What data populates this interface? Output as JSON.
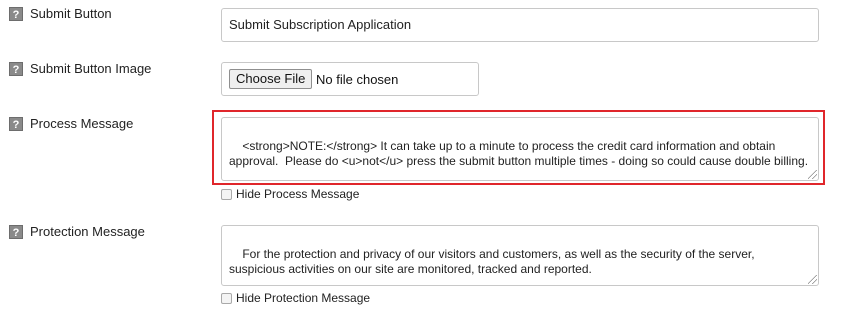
{
  "fields": {
    "submit_button": {
      "help_icon": "?",
      "label": "Submit Button",
      "value": "Submit Subscription Application"
    },
    "submit_button_image": {
      "help_icon": "?",
      "label": "Submit Button Image",
      "choose_file_label": "Choose File",
      "file_status": "No file chosen"
    },
    "process_message": {
      "help_icon": "?",
      "label": "Process Message",
      "value": "<strong>NOTE:</strong> It can take up to a minute to process the credit card information and obtain approval.  Please do <u>not</u> press the submit button multiple times - doing so could cause double billing.",
      "hide_checkbox_label": "Hide Process Message",
      "hide_checked": false
    },
    "protection_message": {
      "help_icon": "?",
      "label": "Protection Message",
      "value": "For the protection and privacy of our visitors and customers, as well as the security of the server, suspicious activities on our site are monitored, tracked and reported.",
      "hide_checkbox_label": "Hide Protection Message",
      "hide_checked": false
    }
  },
  "colors": {
    "highlight_border": "#e0262b",
    "help_icon_bg": "#8a8a8a"
  }
}
